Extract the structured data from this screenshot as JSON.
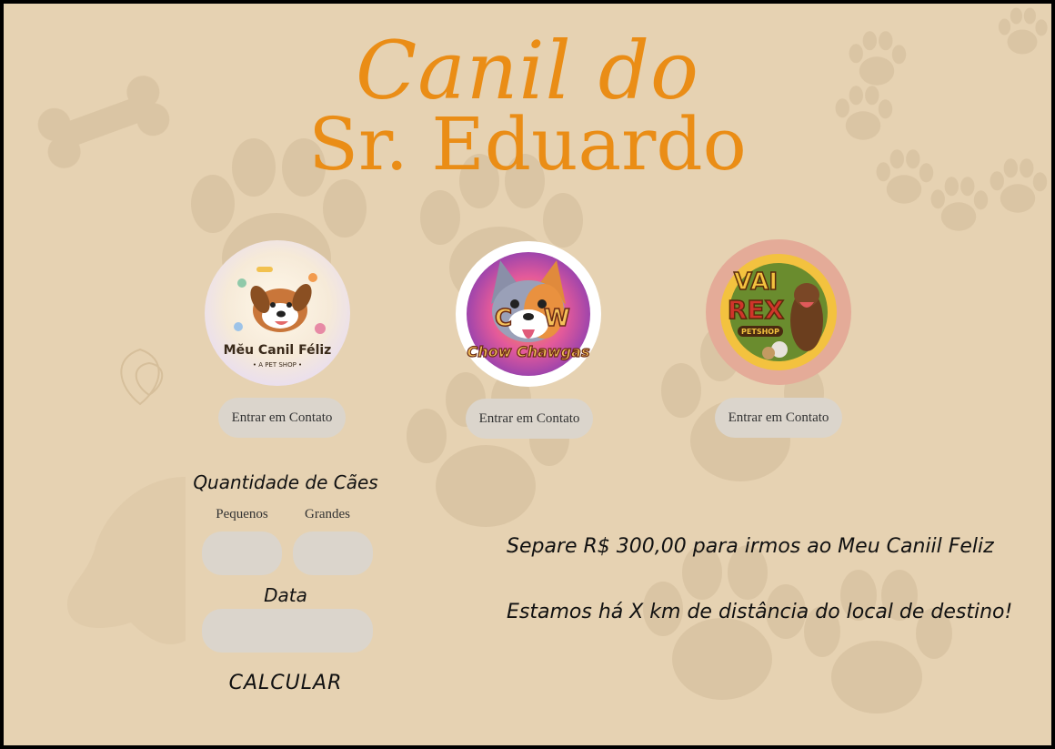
{
  "header": {
    "title_line1": "Canil do",
    "title_line2": "Sr. Eduardo"
  },
  "partners": [
    {
      "name": "Meu Canil Féliz",
      "tagline": "A PET SHOP",
      "button_label": "Entrar em Contato",
      "logo_icon": "happy-dog-logo"
    },
    {
      "name": "Chow Chawgas",
      "initials": "CW",
      "button_label": "Entrar em Contato",
      "logo_icon": "corgi-logo"
    },
    {
      "name_top": "VAI",
      "name_bottom": "REX",
      "tagline": "PETSHOP",
      "button_label": "Entrar em Contato",
      "logo_icon": "dog-cat-logo"
    }
  ],
  "form": {
    "quantity_label": "Quantidade de Cães",
    "small_label": "Pequenos",
    "large_label": "Grandes",
    "small_value": "",
    "large_value": "",
    "date_label": "Data",
    "date_value": "",
    "calculate_label": "CALCULAR"
  },
  "results": {
    "budget_message": "Separe R$ 300,00 para irmos ao Meu Caniil Feliz",
    "distance_message": "Estamos há X km de distância do local de destino!"
  },
  "colors": {
    "background": "#e6d2b2",
    "title": "#ea8d16",
    "button": "#dbd5cc",
    "watermark": "#d7c09e"
  }
}
